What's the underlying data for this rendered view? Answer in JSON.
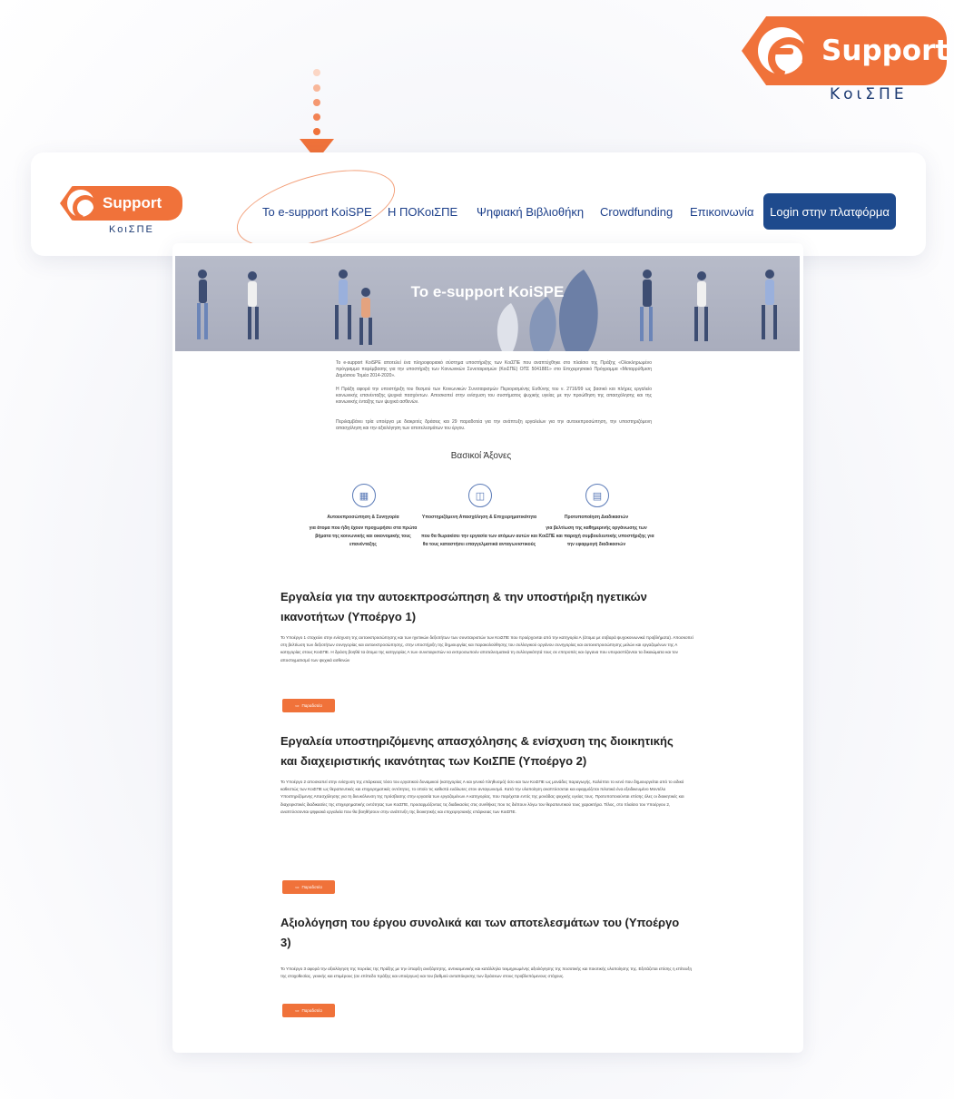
{
  "brand": {
    "name": "Support",
    "sub": "ΚοιΣΠΕ"
  },
  "nav": {
    "items": [
      {
        "label": "Το e-support KoiSPE",
        "active": true
      },
      {
        "label": "Η ΠΟΚοιΣΠΕ"
      },
      {
        "label": "Ψηφιακή Βιβλιοθήκη"
      },
      {
        "label": "Crowdfunding"
      },
      {
        "label": "Επικοινωνία"
      }
    ],
    "login_label": "Login στην πλατφόρμα"
  },
  "hero": {
    "title": "Το e-support KoiSPE"
  },
  "intro": [
    "Το e-support KoiSPE αποτελεί ένα πληροφοριακό σύστημα υποστήριξης των ΚοιΣΠΕ που αναπτύχθηκε στο πλαίσιο της Πράξης «Ολοκληρωμένο πρόγραμμα παρέμβασης για την υποστήριξη των Κοινωνικών Συνεταιρισμών (ΚοιΣΠΕ) ΟΠΣ 5041881» στο Επιχειρησιακό Πρόγραμμα «Μεταρρύθμιση Δημόσιου Τομέα 2014-2020».",
    "Η Πράξη αφορά την υποστήριξη του θεσμού των Κοινωνικών Συνεταιρισμών Περιορισμένης Ευθύνης του ν. 2716/99 ως βασικό και πλήρες εργαλείο κοινωνικής επανένταξης ψυχικά πασχόντων. Αποσκοπεί στην ενίσχυση του συστήματος ψυχικής υγείας με την προώθηση της απασχόλησης και της κοινωνικής ένταξης των ψυχικά ασθενών.",
    "Περιλαμβάνει τρία υποέργα με διακριτές δράσεις και 29 παραδοτέα για την ανάπτυξη εργαλείων για την αυτοεκπροσώπηση, την υποστηριζόμενη απασχόληση και την αξιολόγηση των αποτελεσμάτων του έργου."
  ],
  "axes": {
    "title": "Βασικοί Άξονες",
    "items": [
      {
        "icon": "network-icon",
        "title": "Αυτοεκπροσώπηση & Συνηγορία",
        "text": "για άτομα που ήδη έχουν προχωρήσει στα πρώτα βήματα της κοινωνικής και οικονομικής τους επανένταξης"
      },
      {
        "icon": "briefcase-icon",
        "title": "Υποστηριζόμενη Απασχόληση & Επιχειρηματικότητα",
        "text": "που θα θωρακίσει την εργασία των ατόμων αυτών και θα τους καταστήσει επαγγελματικά ανταγωνιστικούς"
      },
      {
        "icon": "document-icon",
        "title": "Προτυποποίηση Διαδικασιών",
        "text": "για βελτίωση της καθημερινής οργάνωσης των ΚοιΣΠΕ και παροχή συμβουλευτικής υποστήριξης για την εφαρμογή διαδικασιών"
      }
    ]
  },
  "sections": [
    {
      "heading": "Εργαλεία για την αυτοεκπροσώπηση & την υποστήριξη ηγετικών ικανοτήτων (Υποέργο 1)",
      "text": "Το Υποέργο 1 στοχεύει στην ενίσχυση της αυτοεκπροσώπησης και των ηγετικών δεξιοτήτων των συνεταιριστών των ΚοιΣΠΕ που προέρχονται από την κατηγορία Α (άτομα με σοβαρά ψυχοκοινωνικά προβλήματα). Αποσκοπεί στη βελτίωση των δεξιοτήτων συνηγορίας και αυτοεκπροσώπησης, στην υποστήριξη της δημιουργίας και παρακολούθησης του συλλογικού οργάνου συνηγορίας και αυτοεκπροσώπησης μελών και εργαζομένων της Α κατηγορίας στους ΚοιΣΠΕ. Η δράση βοηθά τα άτομα της κατηγορίας Α των συνεταιριστών να εκπροσωπούν αποτελεσματικά τη συλλογικότητά τους σε επιτροπές και όργανα που υπερασπίζονται τα δικαιώματα και τον αποστιγματισμό των ψυχικά ασθενών",
      "button": "Παραδοτέα"
    },
    {
      "heading": "Εργαλεία υποστηριζόμενης απασχόλησης & ενίσχυση της διοικητικής και διαχειριστικής ικανότητας των ΚοιΣΠΕ (Υποέργο 2)",
      "text": "Το Υποέργο 2 αποσκοπεί στην ενίσχυση της επάρκειας τόσο του εργατικού δυναμικού (κατηγορίας Α και γενικό πληθυσμό) όσο και των ΚοιΣΠΕ ως μονάδες παραγωγής. Καλύπτει το κενό που δημιουργείται από το ειδικό καθεστώς των ΚοιΣΠΕ ως θεραπευτικές και επιχειρηματικές οντότητες, το οποίο τις καθιστά ευάλωτες στον ανταγωνισμό. Κατά την υλοποίηση αναπτύσσεται και εφαρμόζεται πιλοτικά ένα εξειδικευμένο Μοντέλο Υποστηριζόμενης Απασχόλησης για τη διευκόλυνση της πρόσβασης στην εργασία των εργαζομένων Α κατηγορίας, που παρέχεται εντός της μονάδας ψυχικής υγείας τους. Προτυποποιούνται επίσης όλες οι διοικητικές και διαχειριστικές διαδικασίες της επιχειρηματικής οντότητας των ΚοιΣΠΕ, προσαρμόζοντας τις διαδικασίες στις συνθήκες που τις διέπουν λόγω του θεραπευτικού τους χαρακτήρα. Τέλος, στο πλαίσιο του Υποέργου 2, αναπτύσσονται ψηφιακά εργαλεία που θα βοηθήσουν στην ανάπτυξη της διοικητικής και επιχειρησιακής επάρκειας των ΚοιΣΠΕ.",
      "button": "Παραδοτέα"
    },
    {
      "heading": "Αξιολόγηση του έργου συνολικά και των αποτελεσμάτων του (Υποέργο 3)",
      "text": "Το Υποέργο 3 αφορά την αξιολόγηση της πορείας της Πράξης με την ύπαρξη ανεξάρτητης, αντικειμενικής και κατάλληλα τεκμηριωμένης αξιολόγησης της ποσοτικής και ποιοτικής υλοποίησης της. Εξετάζεται επίσης η επίτευξη της στοχοθεσίας, γενικής και επιμέρους (σε επίπεδο πράξης και υποέργων) και του βαθμού ανταπόκρισης των δράσεων στους προβλεπόμενους στόχους.",
      "button": "Παραδοτέα"
    }
  ]
}
